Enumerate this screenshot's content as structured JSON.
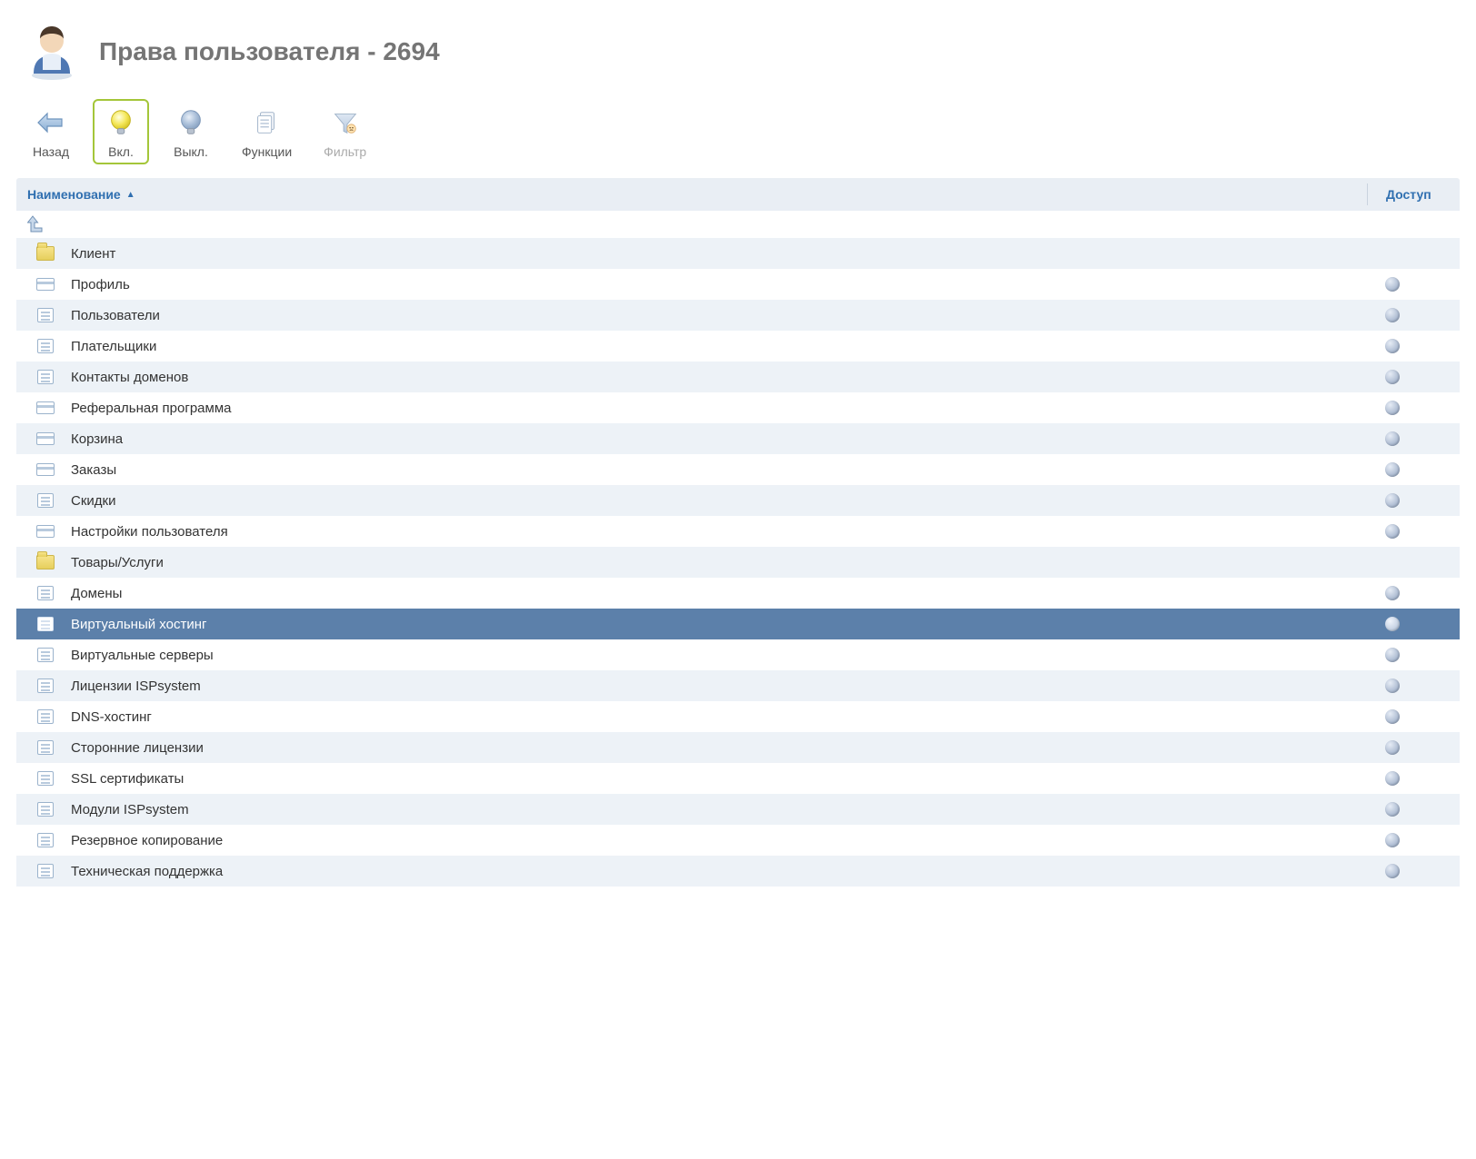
{
  "header": {
    "title": "Права пользователя - 2694"
  },
  "toolbar": {
    "back": {
      "label": "Назад"
    },
    "enable": {
      "label": "Вкл."
    },
    "disable": {
      "label": "Выкл."
    },
    "funcs": {
      "label": "Функции"
    },
    "filter": {
      "label": "Фильтр"
    }
  },
  "columns": {
    "name": "Наименование",
    "access": "Доступ"
  },
  "rows": [
    {
      "icon": "folder",
      "label": "Клиент",
      "access": null
    },
    {
      "icon": "card",
      "label": "Профиль",
      "access": "off"
    },
    {
      "icon": "list",
      "label": "Пользователи",
      "access": "off"
    },
    {
      "icon": "list",
      "label": "Плательщики",
      "access": "off"
    },
    {
      "icon": "list",
      "label": "Контакты доменов",
      "access": "off"
    },
    {
      "icon": "card",
      "label": "Реферальная программа",
      "access": "off"
    },
    {
      "icon": "card",
      "label": "Корзина",
      "access": "off"
    },
    {
      "icon": "card",
      "label": "Заказы",
      "access": "off"
    },
    {
      "icon": "list",
      "label": "Скидки",
      "access": "off"
    },
    {
      "icon": "card",
      "label": "Настройки пользователя",
      "access": "off"
    },
    {
      "icon": "folder",
      "label": "Товары/Услуги",
      "access": null
    },
    {
      "icon": "list",
      "label": "Домены",
      "access": "off"
    },
    {
      "icon": "list",
      "label": "Виртуальный хостинг",
      "access": "off",
      "selected": true
    },
    {
      "icon": "list",
      "label": "Виртуальные серверы",
      "access": "off"
    },
    {
      "icon": "list",
      "label": "Лицензии ISPsystem",
      "access": "off"
    },
    {
      "icon": "list",
      "label": "DNS-хостинг",
      "access": "off"
    },
    {
      "icon": "list",
      "label": "Сторонние лицензии",
      "access": "off"
    },
    {
      "icon": "list",
      "label": "SSL сертификаты",
      "access": "off"
    },
    {
      "icon": "list",
      "label": "Модули ISPsystem",
      "access": "off"
    },
    {
      "icon": "list",
      "label": "Резервное копирование",
      "access": "off"
    },
    {
      "icon": "list",
      "label": "Техническая поддержка",
      "access": "off"
    }
  ]
}
